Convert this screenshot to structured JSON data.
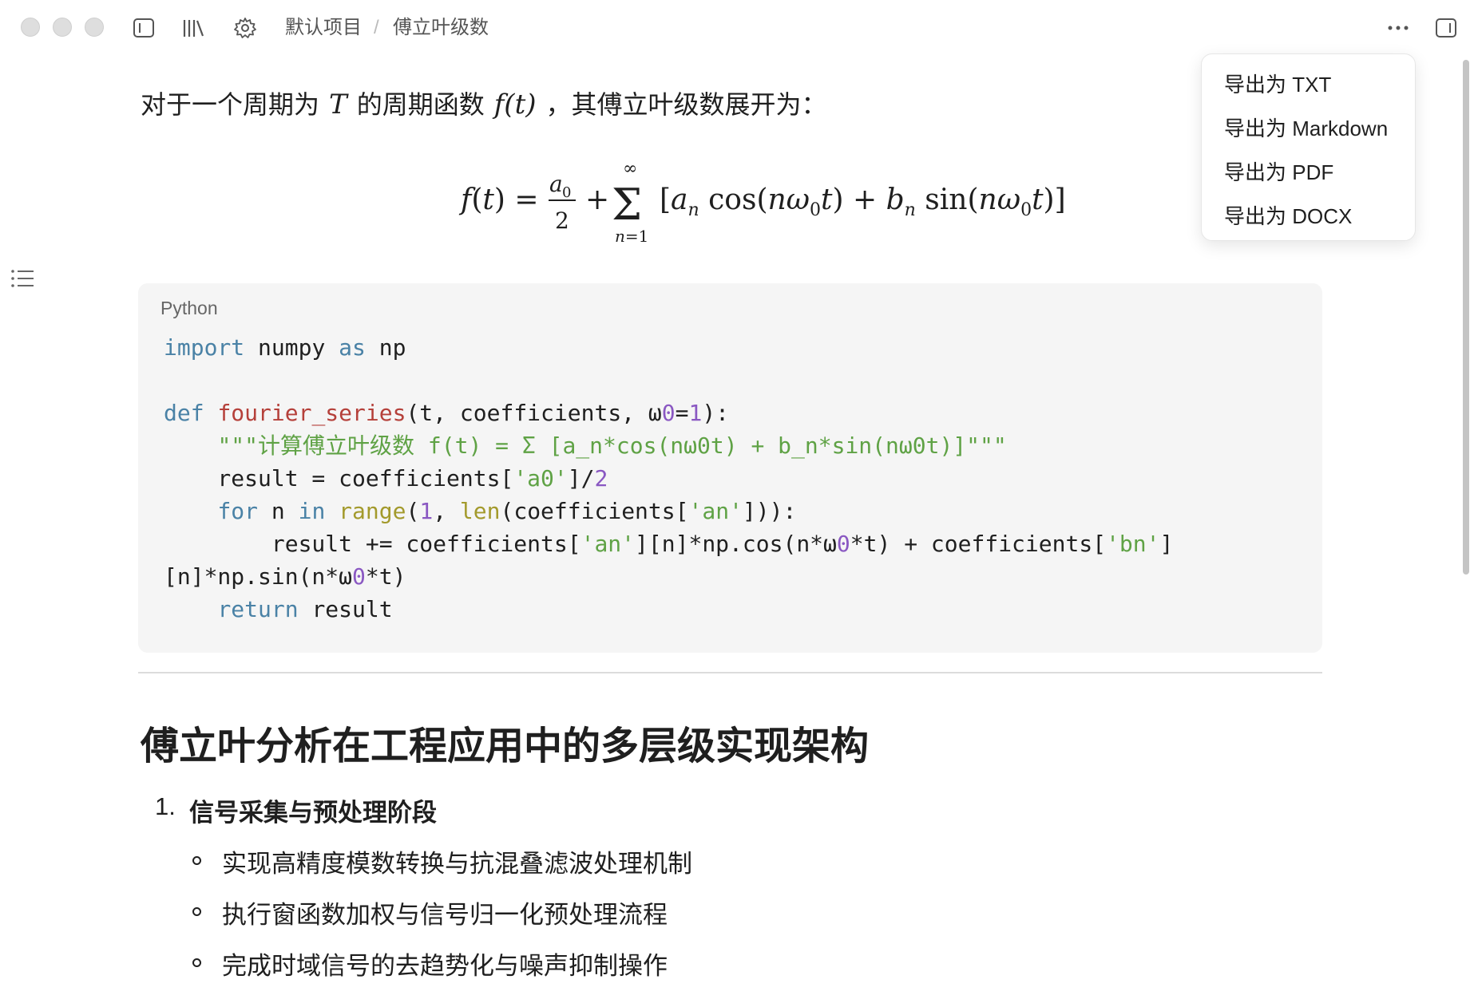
{
  "titlebar": {
    "breadcrumb": [
      "默认项目",
      "傅立叶级数"
    ],
    "separator": "/"
  },
  "intro": {
    "part1": "对于一个周期为",
    "var_T": "T",
    "part2": "的周期函数",
    "var_f": "f(t)",
    "part3": "，其傅立叶级数展开为："
  },
  "formula": "f(t) = a0/2 + Σ_{n=1}^{∞} [a_n cos(nω0 t) + b_n sin(nω0 t)]",
  "code": {
    "language": "Python"
  },
  "section": {
    "heading": "傅立叶分析在工程应用中的多层级实现架构",
    "ol_number": "1.",
    "ol_title": "信号采集与预处理阶段",
    "bullets": [
      "实现高精度模数转换与抗混叠滤波处理机制",
      "执行窗函数加权与信号归一化预处理流程",
      "完成时域信号的去趋势化与噪声抑制操作"
    ]
  },
  "export_menu": {
    "items": [
      "导出为 TXT",
      "导出为 Markdown",
      "导出为 PDF",
      "导出为 DOCX"
    ]
  },
  "icons": [
    "sidebar-toggle-icon",
    "library-icon",
    "gear-icon",
    "more-icon",
    "right-panel-icon",
    "toc-icon"
  ]
}
